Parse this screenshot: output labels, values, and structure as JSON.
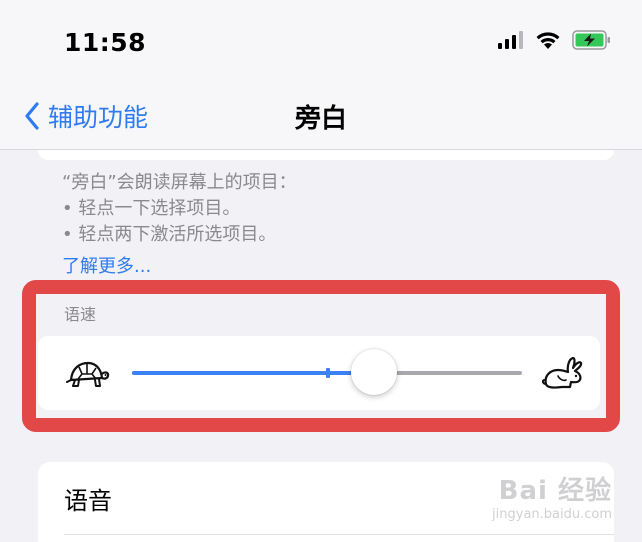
{
  "status_bar": {
    "time": "11:58",
    "icons": [
      "cellular-signal-icon",
      "wifi-icon",
      "battery-charging-icon"
    ]
  },
  "nav": {
    "back_label": "辅助功能",
    "title": "旁白"
  },
  "description": {
    "lines": [
      "“旁白”会朗读屏幕上的项目：",
      "• 轻点一下选择项目。",
      "• 轻点两下激活所选项目。"
    ],
    "learn_more": "了解更多..."
  },
  "speaking_rate": {
    "label": "语速",
    "value_fraction": 0.62,
    "min_icon": "turtle-icon",
    "max_icon": "rabbit-icon"
  },
  "voice": {
    "label": "语音"
  },
  "watermark": {
    "main": "Bai 经验",
    "sub": "jingyan.baidu.com"
  },
  "colors": {
    "accent": "#3a82f5",
    "highlight": "#e24848",
    "battery": "#34c759"
  }
}
